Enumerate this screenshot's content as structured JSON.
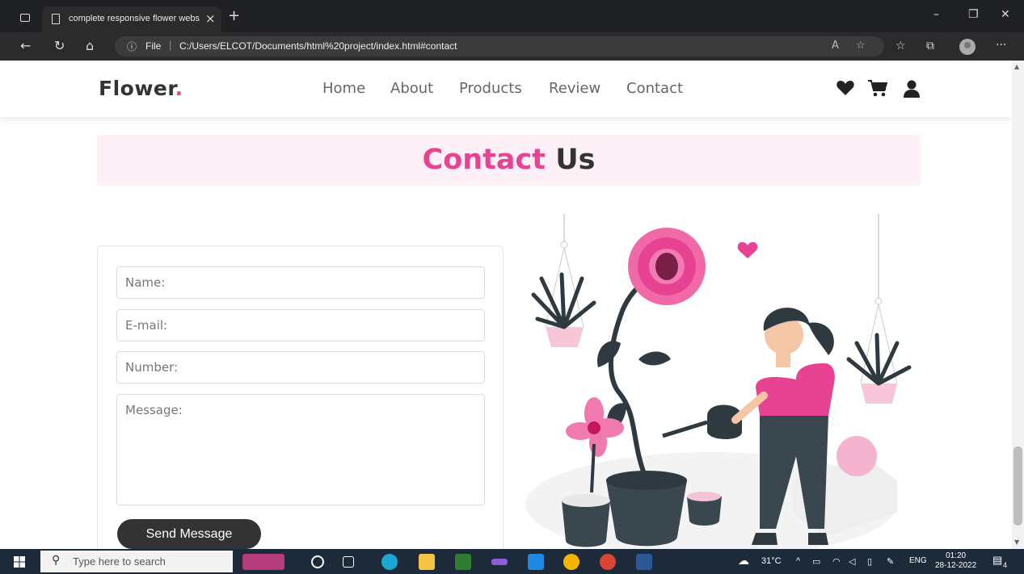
{
  "browser": {
    "tab_title": "complete responsive flower webs",
    "tab_close": "×",
    "new_tab": "+",
    "minimize": "–",
    "restore": "❐",
    "close": "✕",
    "address_info": "ⓘ",
    "address_file": "File",
    "address_sep": "|",
    "url": "C:/Users/ELCOT/Documents/html%20project/index.html#contact",
    "more": "···"
  },
  "site": {
    "logo_main": "Flower",
    "logo_dot": ".",
    "menu": [
      "Home",
      "About",
      "Products",
      "Review",
      "Contact"
    ],
    "icons": [
      "heart-icon",
      "cart-icon",
      "user-icon"
    ],
    "accent": "#e84393",
    "dark": "#333333"
  },
  "contact": {
    "heading_pink": "Contact",
    "heading_dark": "Us",
    "fields": {
      "name_placeholder": "Name:",
      "email_placeholder": "E-mail:",
      "number_placeholder": "Number:",
      "message_placeholder": "Message:"
    },
    "send_label": "Send Message"
  },
  "taskbar": {
    "search_placeholder": "Type here to search",
    "weather": "31°C",
    "lang": "ENG",
    "time": "01:20",
    "date": "28-12-2022",
    "notifications": "4"
  }
}
